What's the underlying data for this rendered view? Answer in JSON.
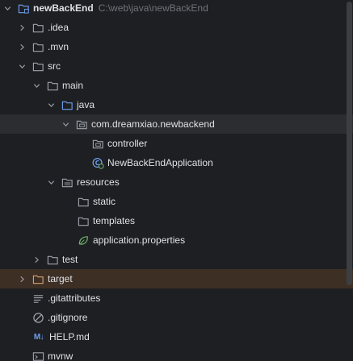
{
  "project": {
    "name": "newBackEnd",
    "path": "C:\\web\\java\\newBackEnd"
  },
  "tree": {
    "idea": ".idea",
    "mvn": ".mvn",
    "src": "src",
    "main": "main",
    "java": "java",
    "package": "com.dreamxiao.newbackend",
    "controller": "controller",
    "app_class": "NewBackEndApplication",
    "resources": "resources",
    "static": "static",
    "templates": "templates",
    "app_properties": "application.properties",
    "test": "test",
    "target": "target",
    "gitattributes": ".gitattributes",
    "gitignore": ".gitignore",
    "help_badge": "M↓",
    "help": "HELP.md",
    "mvnw": "mvnw"
  },
  "colors": {
    "background": "#1e1f22",
    "folder": "#9ea3ab",
    "source_folder": "#6ea0ef",
    "excluded_folder": "#d5a070",
    "spring": "#6fb36b",
    "selected_row": "#2b2d30"
  }
}
